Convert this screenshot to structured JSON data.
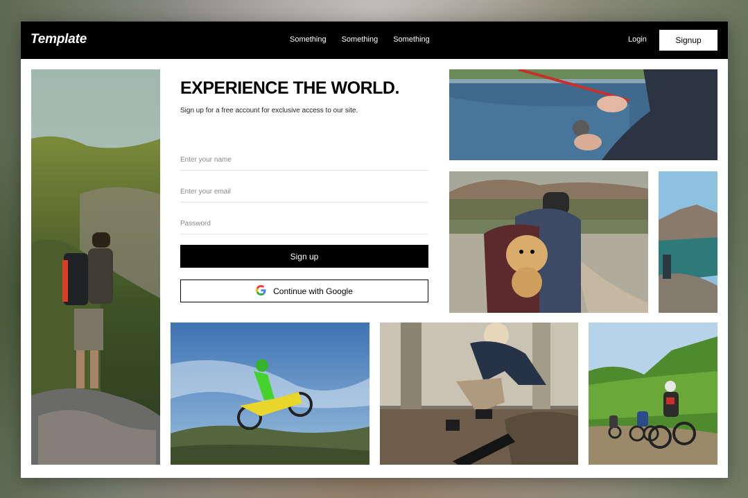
{
  "nav": {
    "brand": "Template",
    "links": [
      "Something",
      "Something",
      "Something"
    ],
    "login": "Login",
    "signup": "Signup"
  },
  "hero": {
    "headline": "EXPERIENCE THE WORLD.",
    "subtitle": "Sign up for a free account for exclusive access to our site."
  },
  "form": {
    "name_placeholder": "Enter your name",
    "email_placeholder": "Enter your email",
    "password_placeholder": "Password",
    "submit_label": "Sign up",
    "google_label": "Continue with Google"
  },
  "colors": {
    "nav_bg": "#000000",
    "primary_button": "#000000",
    "google_red": "#EA4335",
    "google_blue": "#4285F4",
    "google_yellow": "#FBBC05",
    "google_green": "#34A853"
  },
  "gallery": [
    "hiker-photo",
    "fishing-photo",
    "dog-backpack-photo",
    "lake-photo",
    "motocross-photo",
    "skateboard-photo",
    "cyclists-photo"
  ]
}
